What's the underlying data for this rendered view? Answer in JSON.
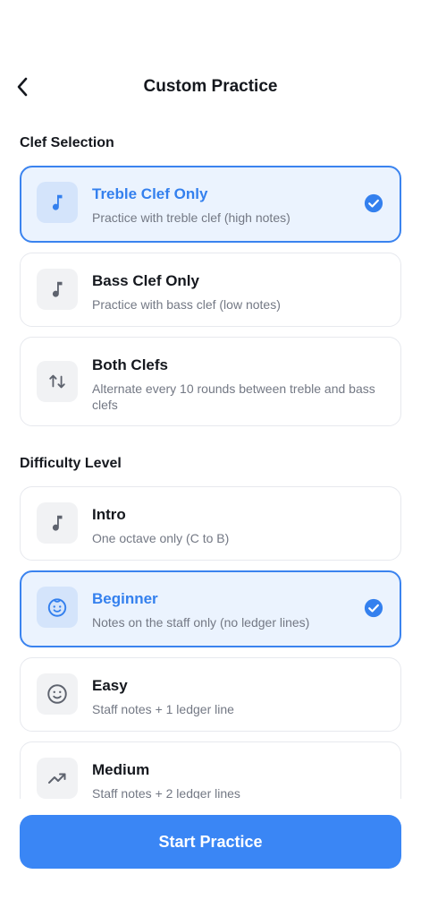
{
  "header": {
    "title": "Custom Practice",
    "back_icon": "chevron-left-icon"
  },
  "clef_section": {
    "title": "Clef Selection",
    "options": [
      {
        "title": "Treble Clef Only",
        "description": "Practice with treble clef (high notes)",
        "icon": "music-note-icon",
        "selected": true
      },
      {
        "title": "Bass Clef Only",
        "description": "Practice with bass clef (low notes)",
        "icon": "music-note-icon",
        "selected": false
      },
      {
        "title": "Both Clefs",
        "description": "Alternate every 10 rounds between treble and bass clefs",
        "icon": "swap-vertical-icon",
        "selected": false
      }
    ]
  },
  "difficulty_section": {
    "title": "Difficulty Level",
    "options": [
      {
        "title": "Intro",
        "description": "One octave only (C to B)",
        "icon": "music-note-icon",
        "selected": false
      },
      {
        "title": "Beginner",
        "description": "Notes on the staff only (no ledger lines)",
        "icon": "baby-face-icon",
        "selected": true
      },
      {
        "title": "Easy",
        "description": "Staff notes + 1 ledger line",
        "icon": "smiley-face-icon",
        "selected": false
      },
      {
        "title": "Medium",
        "description": "Staff notes + 2 ledger lines",
        "icon": "trending-up-icon",
        "selected": false
      }
    ]
  },
  "footer": {
    "start_label": "Start Practice"
  },
  "colors": {
    "accent": "#3a86f5",
    "selected_bg": "#ebf3fe",
    "selected_border": "#3a83ef",
    "icon_bg": "#f1f2f4",
    "text_secondary": "#737884"
  }
}
